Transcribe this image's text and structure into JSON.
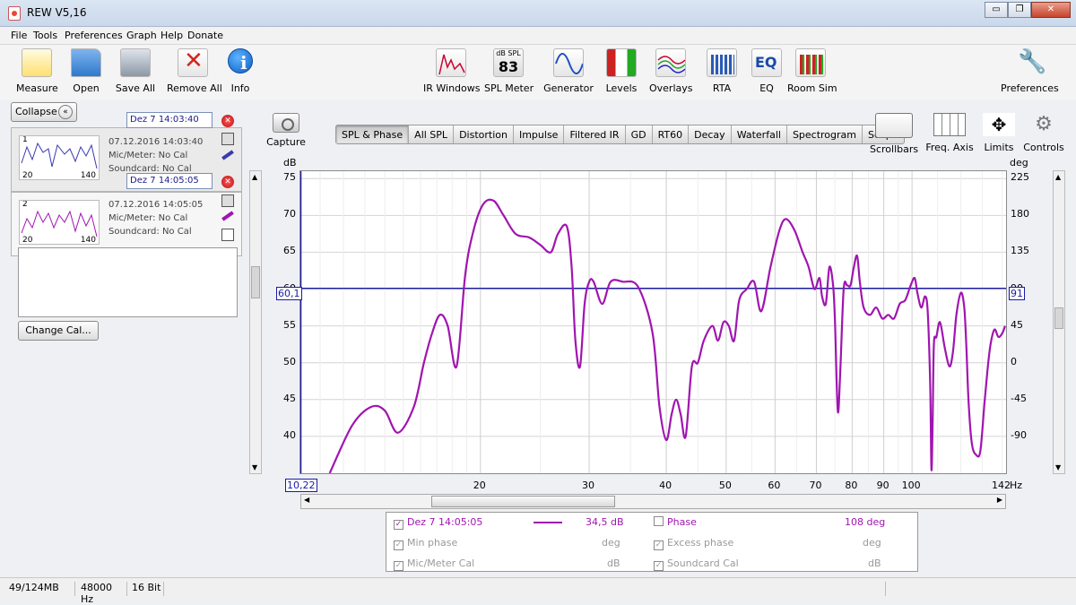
{
  "window": {
    "title": "REW V5,16",
    "minimize": "▭",
    "restore": "❐",
    "close": "✕"
  },
  "menu": [
    "File",
    "Tools",
    "Preferences",
    "Graph",
    "Help",
    "Donate"
  ],
  "toolbar": {
    "measure": "Measure",
    "open": "Open",
    "save_all": "Save All",
    "remove_all": "Remove All",
    "info": "Info",
    "ir_windows": "IR Windows",
    "spl_meter": "SPL Meter",
    "spl_meter_unit": "dB SPL",
    "spl_meter_value": "83",
    "generator": "Generator",
    "levels": "Levels",
    "overlays": "Overlays",
    "rta": "RTA",
    "eq": "EQ",
    "eq_icon_text": "EQ",
    "room_sim": "Room Sim",
    "preferences": "Preferences"
  },
  "left_panel": {
    "collapse": "Collapse",
    "collapse_icon": "«",
    "change_cal": "Change Cal...",
    "measurements": [
      {
        "index": "1",
        "name": "Dez 7 14:03:40",
        "datetime": "07.12.2016 14:03:40",
        "mic": "Mic/Meter: No Cal",
        "soundcard": "Soundcard: No Cal",
        "thumb_min": "20",
        "thumb_max": "140",
        "color": "#3a3ab0"
      },
      {
        "index": "2",
        "name": "Dez 7 14:05:05",
        "datetime": "07.12.2016 14:05:05",
        "mic": "Mic/Meter: No Cal",
        "soundcard": "Soundcard: No Cal",
        "thumb_min": "20",
        "thumb_max": "140",
        "color": "#a015b0"
      }
    ]
  },
  "graph_toolbar": {
    "capture": "Capture",
    "tabs": [
      "SPL & Phase",
      "All SPL",
      "Distortion",
      "Impulse",
      "Filtered IR",
      "GD",
      "RT60",
      "Decay",
      "Waterfall",
      "Spectrogram",
      "Scope"
    ],
    "active_tab": "SPL & Phase",
    "scrollbars": "Scrollbars",
    "freq_axis": "Freq. Axis",
    "limits": "Limits",
    "controls": "Controls"
  },
  "chart_data": {
    "type": "line",
    "xscale": "log",
    "xlim": [
      10.22,
      142
    ],
    "xunit": "Hz",
    "ylim": [
      35,
      76
    ],
    "yunit": "dB",
    "y2lim": [
      -135,
      234
    ],
    "y2unit": "deg",
    "grid": true,
    "x_ticks": [
      20,
      30,
      40,
      50,
      60,
      70,
      80,
      90,
      100
    ],
    "x_min_label": "10,22",
    "x_max_label": "142",
    "y_ticks": [
      40,
      45,
      50,
      55,
      60,
      65,
      70,
      75
    ],
    "y2_ticks": [
      -90,
      -45,
      0,
      45,
      90,
      135,
      180,
      225
    ],
    "cursor": {
      "y_label": "60,1",
      "y2_label": "91",
      "y_value": 60.1
    },
    "series": [
      {
        "name": "Dez 7 14:05:05",
        "color": "#a015b0",
        "x": [
          11.4,
          12.4,
          13.3,
          14.0,
          14.7,
          15.6,
          16.2,
          16.7,
          17.2,
          17.7,
          18.3,
          18.9,
          19.5,
          20.2,
          21.0,
          21.8,
          22.8,
          24.0,
          25.0,
          26.0,
          26.7,
          27.6,
          28.1,
          28.5,
          29.0,
          29.5,
          30.0,
          30.5,
          31.5,
          32.5,
          34.0,
          36.0,
          38.0,
          39.0,
          40.0,
          40.8,
          41.5,
          42.2,
          43.0,
          44.0,
          45.0,
          46.0,
          47.5,
          48.5,
          49.5,
          50.5,
          51.5,
          52.5,
          54.0,
          55.5,
          57.0,
          59.0,
          61.0,
          62.5,
          64.5,
          66.5,
          68.0,
          69.5,
          70.8,
          71.5,
          72.5,
          73.5,
          74.5,
          75.0,
          75.8,
          76.5,
          77.5,
          78.5,
          79.5,
          80.5,
          81.5,
          82.3,
          83.5,
          85.5,
          87.5,
          89.5,
          91.5,
          93.5,
          95.5,
          97.5,
          99.5,
          101.0,
          102.0,
          103.5,
          105.0,
          106.0,
          107.0,
          107.5,
          108.0,
          108.5,
          109.5,
          111.0,
          113.0,
          115.0,
          116.5,
          118.0,
          120.0,
          121.5,
          122.5,
          123.5,
          125.0,
          127.0,
          129.0,
          131.0,
          132.5,
          134.0,
          136.0,
          138.0,
          140.0,
          141.5
        ],
        "y": [
          35,
          41.5,
          44,
          43.5,
          40.5,
          44,
          50,
          54,
          56.5,
          55,
          49.5,
          62,
          68,
          71.5,
          72,
          70,
          67.5,
          67,
          66,
          65,
          67.5,
          68.5,
          63,
          53,
          49.5,
          58,
          61,
          61,
          58,
          61,
          61,
          60.3,
          54,
          44,
          39.5,
          43,
          45,
          43,
          40,
          49.5,
          50,
          53,
          55,
          53,
          55.5,
          55,
          53,
          58.5,
          60,
          61,
          57,
          63,
          68,
          69.5,
          68,
          65,
          63,
          60,
          61.5,
          59,
          58,
          63,
          60.5,
          56,
          43.5,
          48.5,
          60,
          60.5,
          60.5,
          63,
          64.5,
          61,
          57.5,
          56.5,
          57.5,
          56,
          56.5,
          56,
          58,
          58.5,
          60.5,
          61.5,
          59.5,
          57.5,
          59,
          57,
          47,
          35.5,
          42,
          52.5,
          53.5,
          55.5,
          52,
          49.5,
          51.5,
          56.5,
          59.5,
          57.5,
          52,
          44.5,
          39,
          37.5,
          38,
          44.5,
          49,
          52.5,
          54.5,
          53.5,
          54,
          55
        ]
      }
    ]
  },
  "legend": {
    "row1": {
      "name": "Dez 7 14:05:05",
      "value": "34,5 dB",
      "phase_label": "Phase",
      "phase_value": "108 deg"
    },
    "row2": {
      "left_label": "Min phase",
      "left_unit": "deg",
      "right_label": "Excess phase",
      "right_unit": "deg"
    },
    "row3": {
      "left_label": "Mic/Meter Cal",
      "left_unit": "dB",
      "right_label": "Soundcard Cal",
      "right_unit": "dB"
    },
    "check": "✓"
  },
  "status": {
    "memory": "49/124MB",
    "sample_rate": "48000 Hz",
    "bit_depth": "16 Bit"
  }
}
